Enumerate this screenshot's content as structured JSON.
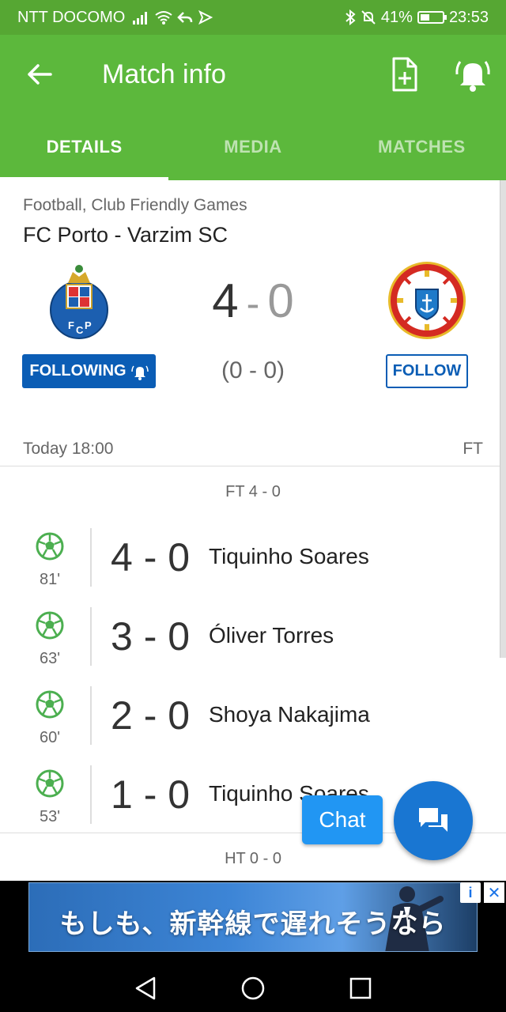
{
  "status_bar": {
    "carrier": "NTT DOCOMO",
    "battery": "41%",
    "battery_level": 0.41,
    "time": "23:53"
  },
  "app_bar": {
    "title": "Match info",
    "icons": [
      "back-arrow-icon",
      "add-document-icon",
      "bell-alert-icon"
    ]
  },
  "tabs": [
    {
      "label": "DETAILS",
      "active": true
    },
    {
      "label": "MEDIA",
      "active": false
    },
    {
      "label": "MATCHES",
      "active": false
    }
  ],
  "match": {
    "category": "Football, Club Friendly Games",
    "title": "FC Porto - Varzim SC",
    "home_score": "4",
    "away_score": "0",
    "score_separator": "-",
    "halftime_score": "(0 - 0)",
    "home_follow_label": "FOLLOWING",
    "away_follow_label": "FOLLOW",
    "kickoff": "Today 18:00",
    "status": "FT"
  },
  "periods": {
    "fulltime_label": "FT 4 - 0",
    "halftime_label": "HT 0 - 0"
  },
  "events": [
    {
      "minute": "81'",
      "score": "4 - 0",
      "player": "Tiquinho Soares"
    },
    {
      "minute": "63'",
      "score": "3 - 0",
      "player": "Óliver Torres"
    },
    {
      "minute": "60'",
      "score": "2 - 0",
      "player": "Shoya Nakajima"
    },
    {
      "minute": "53'",
      "score": "1 - 0",
      "player": "Tiquinho Soares"
    }
  ],
  "chat": {
    "label": "Chat"
  },
  "ad": {
    "text": "もしも、新幹線で遅れそうなら"
  },
  "colors": {
    "status_bar": "#56a733",
    "app_bar": "#5cb83c",
    "primary_blue": "#0b5db5",
    "fab": "#1976d2",
    "chat": "#2196f3"
  }
}
